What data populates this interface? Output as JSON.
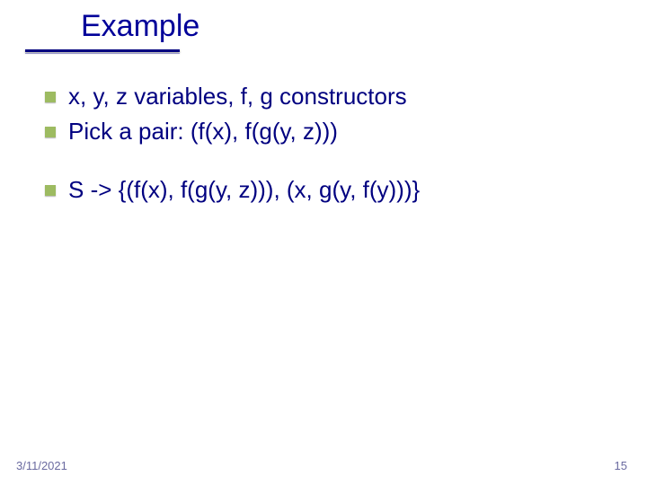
{
  "slide": {
    "title": "Example",
    "bullets_group1": [
      "x, y, z variables, f, g constructors",
      "Pick a pair: (f(x), f(g(y, z)))"
    ],
    "bullets_group2": [
      "S -> {(f(x), f(g(y, z))), (x, g(y, f(y)))}"
    ]
  },
  "footer": {
    "date": "3/11/2021",
    "page": "15"
  }
}
